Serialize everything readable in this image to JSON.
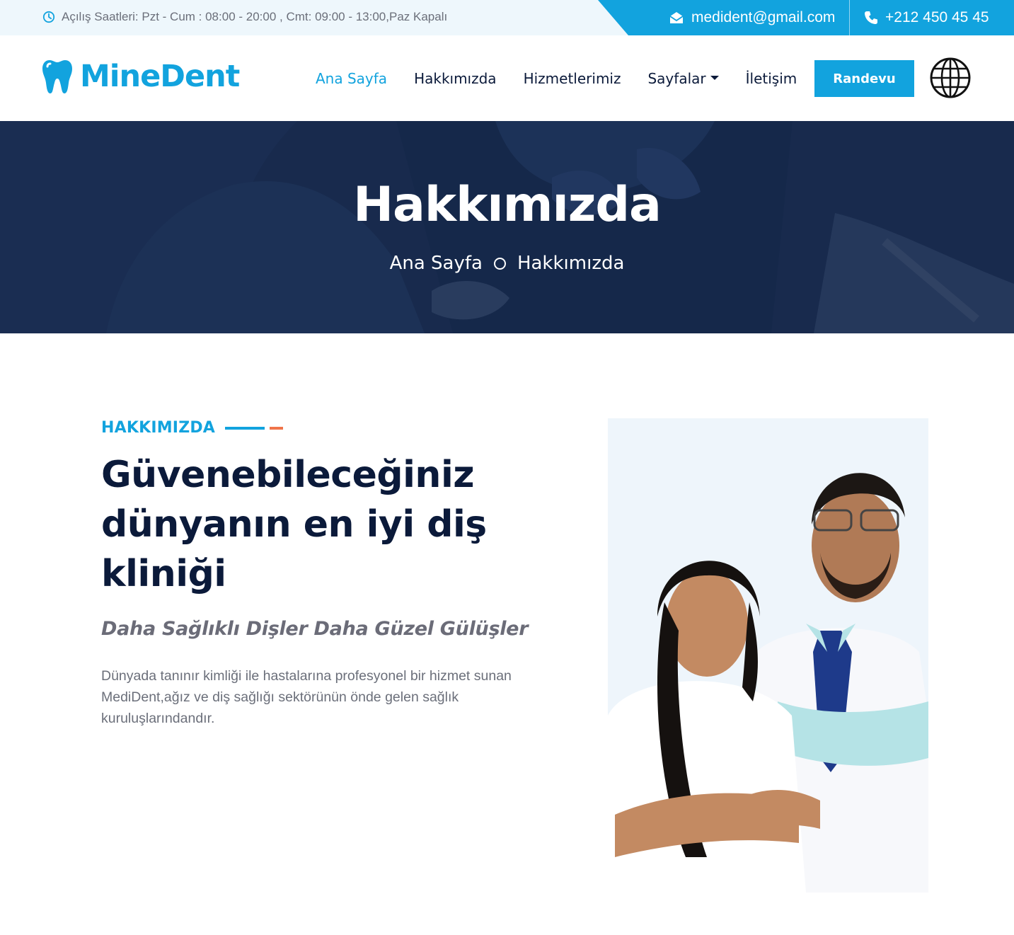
{
  "topbar": {
    "hours": "Açılış Saatleri: Pzt - Cum : 08:00 - 20:00 , Cmt: 09:00 - 13:00,Paz Kapalı",
    "email": "medident@gmail.com",
    "phone": "+212 450 45 45"
  },
  "logo": {
    "text": "MineDent"
  },
  "nav": {
    "items": [
      {
        "label": "Ana Sayfa"
      },
      {
        "label": "Hakkımızda"
      },
      {
        "label": "Hizmetlerimiz"
      },
      {
        "label": "Sayfalar"
      },
      {
        "label": "İletişim"
      }
    ],
    "cta": "Randevu"
  },
  "hero": {
    "title": "Hakkımızda",
    "breadcrumb": [
      "Ana Sayfa",
      "Hakkımızda"
    ]
  },
  "about": {
    "eyebrow": "HAKKIMIZDA",
    "heading_lines": [
      "Güvenebileceğiniz",
      "dünyanın en iyi diş",
      "kliniği"
    ],
    "subheading": "Daha Sağlıklı Dişler Daha Güzel Gülüşler",
    "text": "Dünyada tanınır kimliği ile hastalarına profesyonel bir hizmet sunan MediDent,ağız ve diş sağlığı sektörünün önde gelen sağlık kuruluşlarındandır."
  },
  "colors": {
    "accent": "#12a3de",
    "navy": "#0b1a3a",
    "orange": "#f0744a",
    "muted": "#6b6f7a"
  }
}
